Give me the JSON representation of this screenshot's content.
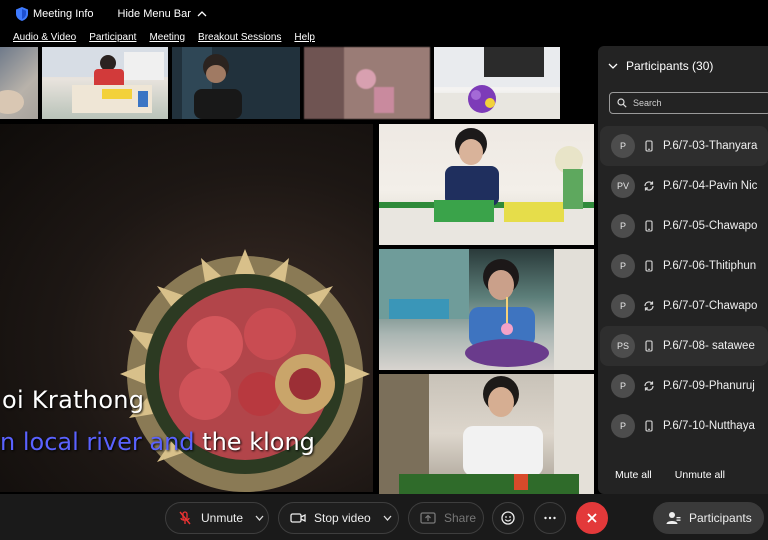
{
  "topbar": {
    "meeting_info": "Meeting Info",
    "hide_menu": "Hide Menu Bar"
  },
  "menu": [
    "Audio & Video",
    "Participant",
    "Meeting",
    "Breakout Sessions",
    "Help"
  ],
  "main_video": {
    "subtitle_line1": "oi Krathong",
    "subtitle_line2_highlight": "n local river and",
    "subtitle_line2_rest": " the klong"
  },
  "participants_panel": {
    "title": "Participants (30)",
    "search_placeholder": "Search",
    "participants": [
      {
        "initials": "P",
        "name": "P.6/7-03-Thanyara",
        "device": "mobile-icon",
        "selected": true
      },
      {
        "initials": "PV",
        "name": "P.6/7-04-Pavin Nic",
        "device": "sync-icon",
        "selected": false
      },
      {
        "initials": "P",
        "name": "P.6/7-05-Chawapo",
        "device": "mobile-icon",
        "selected": false
      },
      {
        "initials": "P",
        "name": "P.6/7-06-Thitiphun",
        "device": "mobile-icon",
        "selected": false
      },
      {
        "initials": "P",
        "name": "P.6/7-07-Chawapo",
        "device": "sync-icon",
        "selected": false
      },
      {
        "initials": "PS",
        "name": "P.6/7-08- satawee",
        "device": "mobile-icon",
        "selected": true
      },
      {
        "initials": "P",
        "name": "P.6/7-09-Phanuruj",
        "device": "sync-icon",
        "selected": false
      },
      {
        "initials": "P",
        "name": "P.6/7-10-Nutthaya",
        "device": "mobile-icon",
        "selected": false
      }
    ],
    "mute_all": "Mute all",
    "unmute_all": "Unmute all"
  },
  "toolbar": {
    "unmute": "Unmute",
    "stop_video": "Stop video",
    "share": "Share",
    "participants": "Participants",
    "end_color": "#e3393a"
  }
}
